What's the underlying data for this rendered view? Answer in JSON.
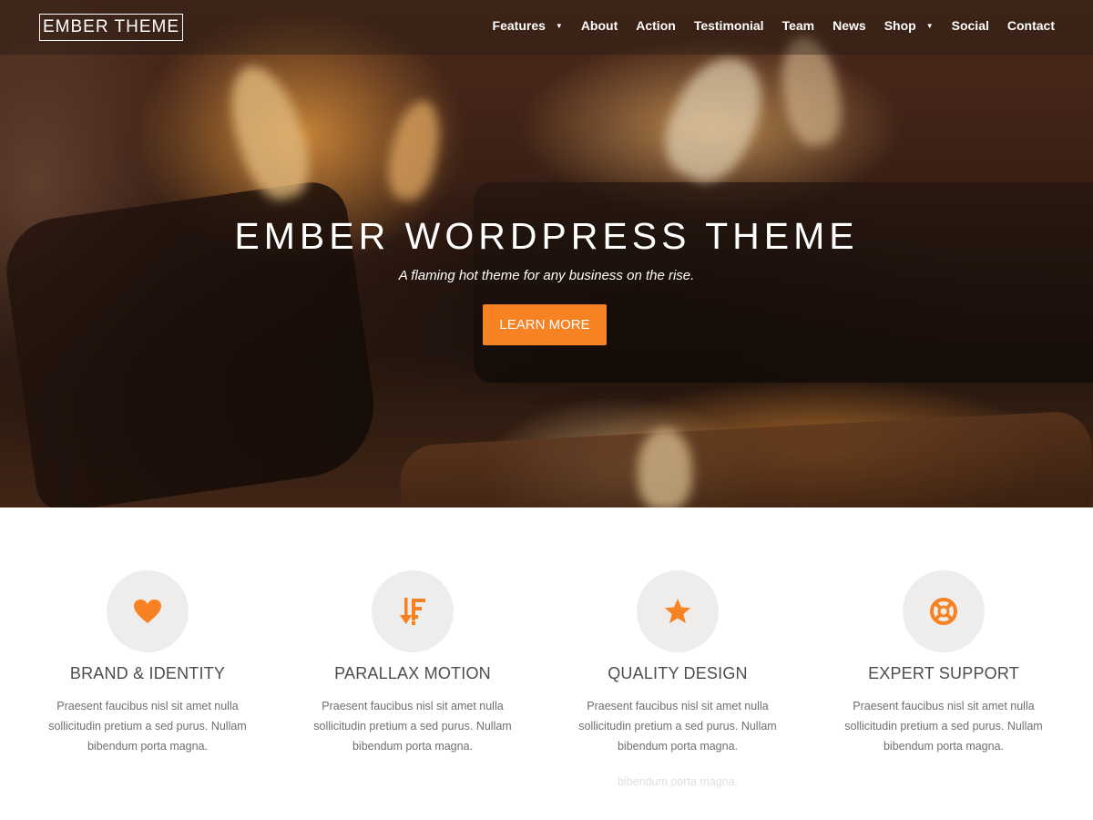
{
  "brand": {
    "logo_text": "EMBER THEME"
  },
  "nav": {
    "items": [
      {
        "label": "Features",
        "has_dropdown": true
      },
      {
        "label": "About",
        "has_dropdown": false
      },
      {
        "label": "Action",
        "has_dropdown": false
      },
      {
        "label": "Testimonial",
        "has_dropdown": false
      },
      {
        "label": "Team",
        "has_dropdown": false
      },
      {
        "label": "News",
        "has_dropdown": false
      },
      {
        "label": "Shop",
        "has_dropdown": true
      },
      {
        "label": "Social",
        "has_dropdown": false
      },
      {
        "label": "Contact",
        "has_dropdown": false
      }
    ],
    "caret_glyph": "▼"
  },
  "hero": {
    "title": "EMBER WORDPRESS THEME",
    "subtitle": "A flaming hot theme for any business on the rise.",
    "button_label": "LEARN MORE"
  },
  "features": [
    {
      "icon": "heart-icon",
      "title": "BRAND & IDENTITY",
      "text": "Praesent faucibus nisl sit amet nulla sollicitudin pretium a sed purus. Nullam bibendum porta magna."
    },
    {
      "icon": "sort-descending-icon",
      "title": "PARALLAX MOTION",
      "text": "Praesent faucibus nisl sit amet nulla sollicitudin pretium a sed purus. Nullam bibendum porta magna."
    },
    {
      "icon": "star-icon",
      "title": "QUALITY DESIGN",
      "text": "Praesent faucibus nisl sit amet nulla sollicitudin pretium a sed purus. Nullam bibendum porta magna."
    },
    {
      "icon": "lifebuoy-icon",
      "title": "EXPERT SUPPORT",
      "text": "Praesent faucibus nisl sit amet nulla sollicitudin pretium a sed purus. Nullam bibendum porta magna."
    }
  ],
  "ghost_text": "bibendum porta magna.",
  "colors": {
    "accent": "#f78223",
    "icon_circle": "#efedeb",
    "heading": "#4d4d4d",
    "body_text": "#6f6f6f"
  }
}
